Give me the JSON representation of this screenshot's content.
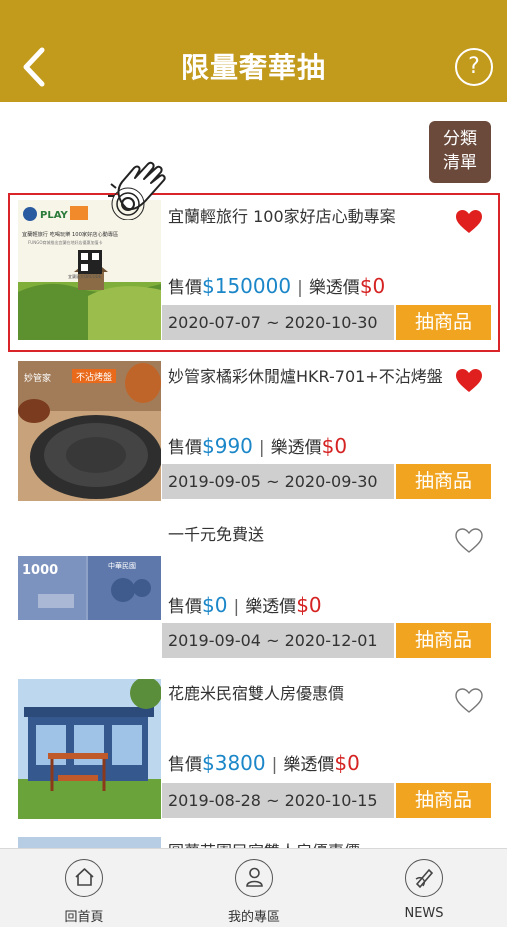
{
  "header": {
    "title": "限量奢華抽",
    "help_label": "?"
  },
  "sort_button": {
    "line1": "分類",
    "line2": "清單"
  },
  "items": [
    {
      "name": "宜蘭輕旅行 100家好店心動專案",
      "price_label": "售價",
      "price": "$150000",
      "lottery_label": "樂透價",
      "lottery_price": "$0",
      "dates": "2020-07-07 ~ 2020-10-30",
      "action": "抽商品",
      "favorited": true,
      "thumb_text": {
        "brand": "PLAY",
        "line1": "宜蘭輕旅行 吃喝玩樂  100家好店心動專區",
        "line2": "FUNGO商城推出宜蘭在地好店優惠加值卡",
        "line3": "宜蘭區大QRCODE"
      }
    },
    {
      "name": "妙管家橘彩休閒爐HKR-701+不沾烤盤",
      "price_label": "售價",
      "price": "$990",
      "lottery_label": "樂透價",
      "lottery_price": "$0",
      "dates": "2019-09-05 ~ 2020-09-30",
      "action": "抽商品",
      "favorited": true,
      "thumb_text": {
        "brand": "妙管家",
        "tag": "不沾烤盤"
      }
    },
    {
      "name": "一千元免費送",
      "price_label": "售價",
      "price": "$0",
      "lottery_label": "樂透價",
      "lottery_price": "$0",
      "dates": "2019-09-04 ~ 2020-12-01",
      "action": "抽商品",
      "favorited": false,
      "thumb_text": {
        "amount": "1000",
        "bank": "中華民國"
      }
    },
    {
      "name": "花鹿米民宿雙人房優惠價",
      "price_label": "售價",
      "price": "$3800",
      "lottery_label": "樂透價",
      "lottery_price": "$0",
      "dates": "2019-08-28 ~ 2020-10-15",
      "action": "抽商品",
      "favorited": false
    }
  ],
  "partial_item_name": "圓夢花園民宿雙人房優惠價",
  "bottom_nav": [
    {
      "label": "回首頁",
      "icon": "home-icon"
    },
    {
      "label": "我的專區",
      "icon": "user-icon"
    },
    {
      "label": "NEWS",
      "icon": "news-icon"
    }
  ],
  "colors": {
    "header": "#c29a1c",
    "sort_button": "#6b4a3c",
    "action_button": "#f0a41f",
    "price_blue": "#1b86c8",
    "price_red": "#d52222",
    "heart_filled": "#e0201e",
    "highlight_border": "#d9252a"
  }
}
